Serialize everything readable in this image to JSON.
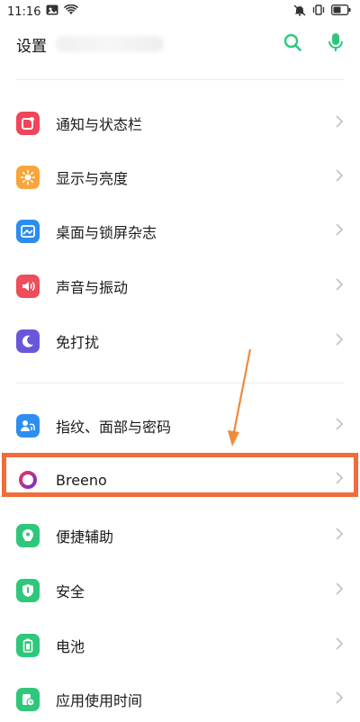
{
  "status_bar": {
    "time": "11:16"
  },
  "header": {
    "title": "设置"
  },
  "settings": {
    "group1": [
      {
        "label": "通知与状态栏",
        "icon": "notification-icon",
        "color": "#f0455a"
      },
      {
        "label": "显示与亮度",
        "icon": "brightness-icon",
        "color": "#f9a53a"
      },
      {
        "label": "桌面与锁屏杂志",
        "icon": "wallpaper-icon",
        "color": "#2c8df0"
      },
      {
        "label": "声音与振动",
        "icon": "sound-icon",
        "color": "#ef4c5c"
      },
      {
        "label": "免打扰",
        "icon": "moon-icon",
        "color": "#6957d9"
      }
    ],
    "group2": [
      {
        "label": "指纹、面部与密码",
        "icon": "fingerprint-icon",
        "color": "#2d8ef0"
      },
      {
        "label": "Breeno",
        "icon": "breeno-icon",
        "color": "#b5248c"
      },
      {
        "label": "便捷辅助",
        "icon": "assist-icon",
        "color": "#2fc77a"
      },
      {
        "label": "安全",
        "icon": "shield-icon",
        "color": "#2fc77a"
      },
      {
        "label": "电池",
        "icon": "battery-icon",
        "color": "#2fc77a"
      },
      {
        "label": "应用使用时间",
        "icon": "app-time-icon",
        "color": "#2fc77a"
      }
    ]
  },
  "colors": {
    "accent": "#2fc77a",
    "highlight": "#f26b3a"
  }
}
